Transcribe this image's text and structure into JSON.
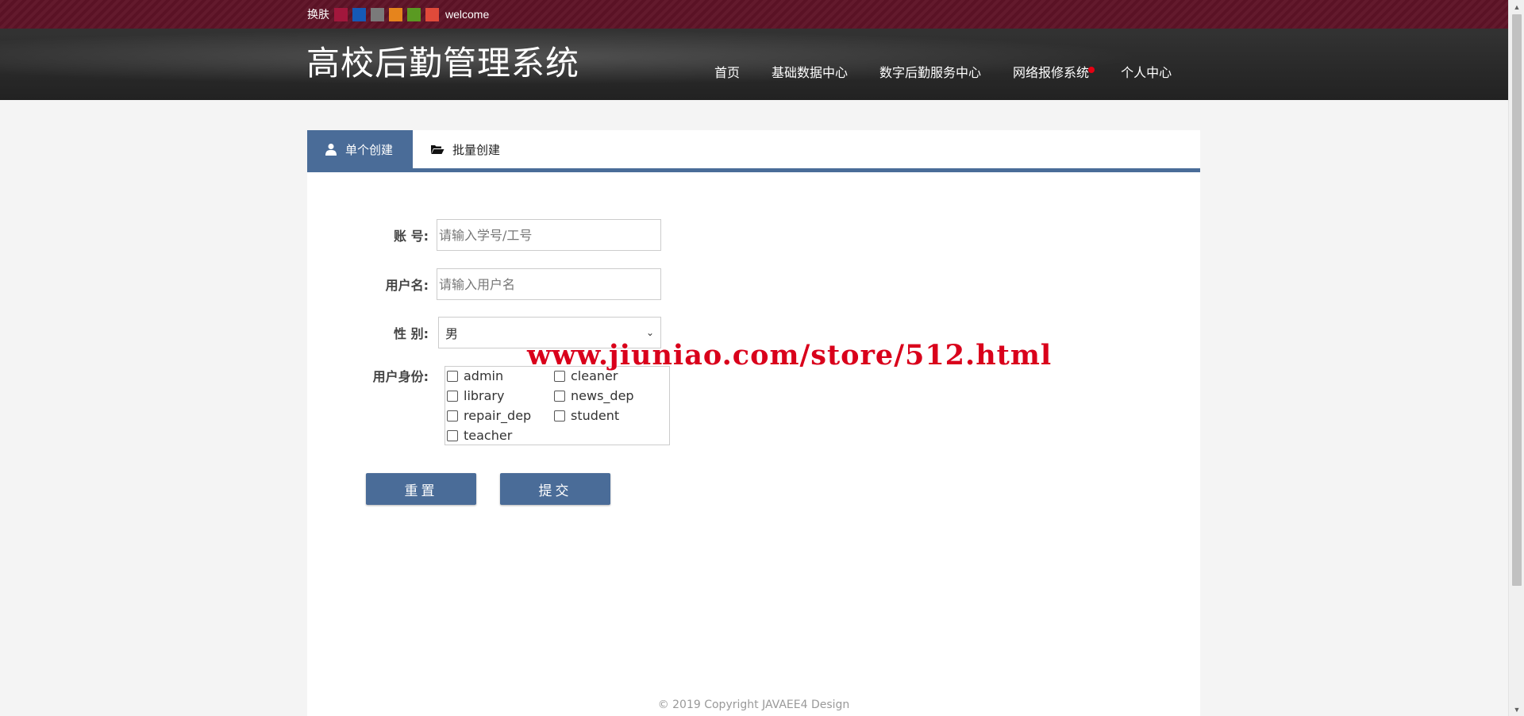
{
  "skin": {
    "label": "换肤",
    "welcome": "welcome",
    "swatches": [
      "#a2173c",
      "#1559b6",
      "#7a7a7a",
      "#e6841c",
      "#5a9a22",
      "#e04a3a"
    ]
  },
  "header": {
    "title": "高校后勤管理系统",
    "nav": [
      {
        "label": "首页"
      },
      {
        "label": "基础数据中心"
      },
      {
        "label": "数字后勤服务中心"
      },
      {
        "label": "网络报修系统",
        "badge": true
      },
      {
        "label": "个人中心"
      }
    ]
  },
  "tabs": [
    {
      "label": "单个创建",
      "icon": "user-icon",
      "active": true
    },
    {
      "label": "批量创建",
      "icon": "folder-open-icon",
      "active": false
    }
  ],
  "form": {
    "account": {
      "label": "账 号:",
      "placeholder": "请输入学号/工号",
      "value": ""
    },
    "username": {
      "label": "用户名:",
      "placeholder": "请输入用户名",
      "value": ""
    },
    "gender": {
      "label": "性 别:",
      "value": "男"
    },
    "roles": {
      "label": "用户身份:",
      "options": [
        "admin",
        "cleaner",
        "library",
        "news_dep",
        "repair_dep",
        "student",
        "teacher"
      ]
    },
    "reset_label": "重置",
    "submit_label": "提交"
  },
  "watermark": "www.jiuniao.com/store/512.html",
  "footer": "© 2019 Copyright JAVAEE4 Design",
  "colors": {
    "accent": "#4a6c98",
    "skinbar": "#5e1326",
    "header": "#262626",
    "badge": "#e60012"
  }
}
